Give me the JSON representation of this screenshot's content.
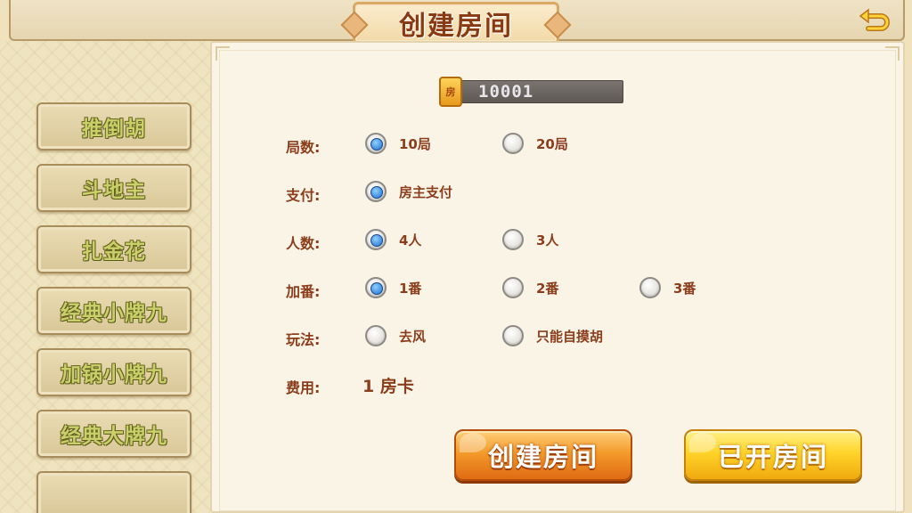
{
  "header": {
    "title": "创建房间",
    "back_icon": "back-arrow-icon"
  },
  "sidebar": {
    "items": [
      {
        "label": "推倒胡"
      },
      {
        "label": "斗地主"
      },
      {
        "label": "扎金花"
      },
      {
        "label": "经典小牌九"
      },
      {
        "label": "加锅小牌九"
      },
      {
        "label": "经典大牌九"
      },
      {
        "label": ""
      }
    ]
  },
  "room": {
    "badge": "房",
    "id": "10001"
  },
  "options": {
    "rounds": {
      "label": "局数:",
      "choices": [
        "10局",
        "20局"
      ],
      "selected": 0
    },
    "payment": {
      "label": "支付:",
      "choices": [
        "房主支付"
      ],
      "selected": 0
    },
    "players": {
      "label": "人数:",
      "choices": [
        "4人",
        "3人"
      ],
      "selected": 0
    },
    "fan": {
      "label": "加番:",
      "choices": [
        "1番",
        "2番",
        "3番"
      ],
      "selected": 0
    },
    "rules": {
      "label": "玩法:",
      "choices": [
        "去风",
        "只能自摸胡"
      ],
      "selected": -1
    },
    "fee": {
      "label": "费用:",
      "value": "1 房卡"
    }
  },
  "buttons": {
    "create": "创建房间",
    "open": "已开房间"
  },
  "colors": {
    "label_brown": "#8b3d1c",
    "create_orange": "#f39b2a",
    "open_yellow": "#ffd42a",
    "radio_blue": "#1e6fd0"
  }
}
